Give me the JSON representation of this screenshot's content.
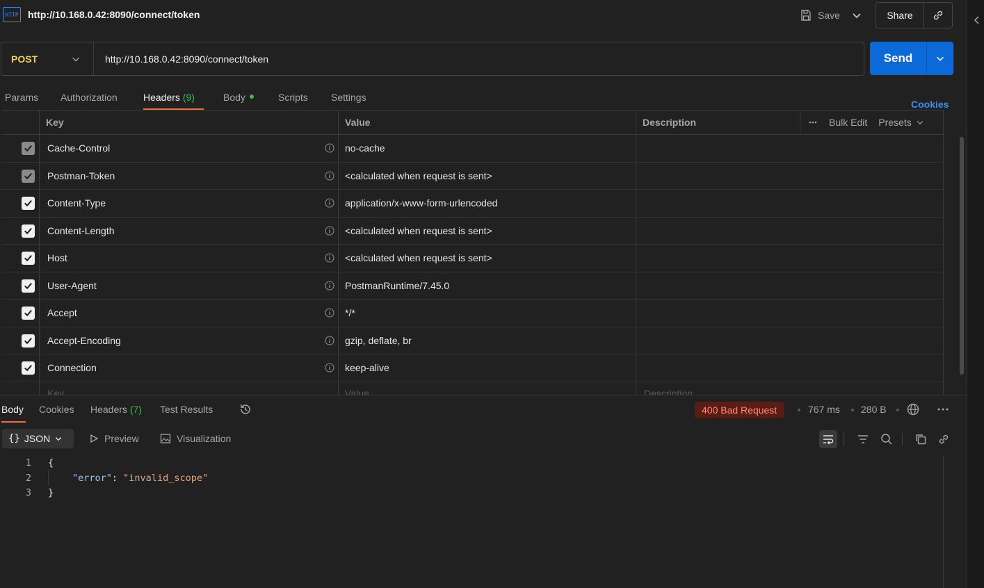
{
  "title_bar": {
    "icon_text": "HTTP",
    "request_title": "http://10.168.0.42:8090/connect/token",
    "save_label": "Save",
    "share_label": "Share"
  },
  "url_bar": {
    "method": "POST",
    "url": "http://10.168.0.42:8090/connect/token",
    "send_label": "Send"
  },
  "request_tabs": {
    "params": "Params",
    "authorization": "Authorization",
    "headers": "Headers",
    "headers_count": "(9)",
    "body": "Body",
    "scripts": "Scripts",
    "settings": "Settings",
    "cookies": "Cookies"
  },
  "headers_table": {
    "columns": {
      "key": "Key",
      "value": "Value",
      "description": "Description"
    },
    "bulk_edit": "Bulk Edit",
    "presets": "Presets",
    "rows": [
      {
        "key": "Cache-Control",
        "value": "no-cache",
        "locked": true
      },
      {
        "key": "Postman-Token",
        "value": "<calculated when request is sent>",
        "locked": true
      },
      {
        "key": "Content-Type",
        "value": "application/x-www-form-urlencoded",
        "locked": false
      },
      {
        "key": "Content-Length",
        "value": "<calculated when request is sent>",
        "locked": false
      },
      {
        "key": "Host",
        "value": "<calculated when request is sent>",
        "locked": false
      },
      {
        "key": "User-Agent",
        "value": "PostmanRuntime/7.45.0",
        "locked": false
      },
      {
        "key": "Accept",
        "value": "*/*",
        "locked": false
      },
      {
        "key": "Accept-Encoding",
        "value": "gzip, deflate, br",
        "locked": false
      },
      {
        "key": "Connection",
        "value": "keep-alive",
        "locked": false
      }
    ],
    "new_row": {
      "key_placeholder": "Key",
      "value_placeholder": "Value",
      "description_placeholder": "Description"
    }
  },
  "response": {
    "tabs": {
      "body": "Body",
      "cookies": "Cookies",
      "headers": "Headers",
      "headers_count": "(7)",
      "test_results": "Test Results"
    },
    "status": "400 Bad Request",
    "time": "767 ms",
    "size": "280 B",
    "format": "JSON",
    "preview": "Preview",
    "visualization": "Visualization",
    "code_lines": [
      {
        "n": "1",
        "text": "{"
      },
      {
        "n": "2",
        "key": "\"error\"",
        "colon": ": ",
        "value": "\"invalid_scope\""
      },
      {
        "n": "3",
        "text": "}"
      }
    ]
  },
  "colors": {
    "accent_blue": "#0c6ad8",
    "method_yellow": "#f2d24b",
    "tab_underline": "#f26b3a",
    "count_green": "#3fb950",
    "error_badge_bg": "#5a1d16",
    "error_badge_text": "#ff8b7a"
  }
}
